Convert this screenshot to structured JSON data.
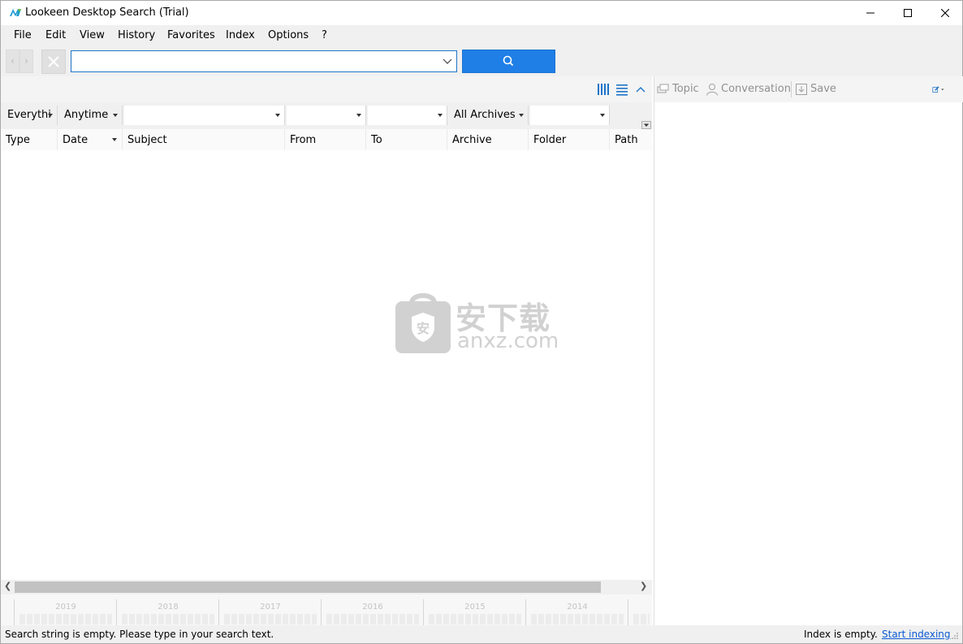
{
  "window": {
    "title": "Lookeen Desktop Search (Trial)",
    "controls": {
      "minimize": "─",
      "maximize": "☐",
      "close": "✕"
    }
  },
  "menu": {
    "items": [
      "File",
      "Edit",
      "View",
      "History",
      "Favorites",
      "Index",
      "Options",
      "?"
    ]
  },
  "toolbar": {
    "back_icon": "‹",
    "forward_icon": "›",
    "search_value": "",
    "search_placeholder": "",
    "search_button_color": "#1f7fe6"
  },
  "filters": [
    {
      "label": "Everythin"
    },
    {
      "label": "Anytime"
    },
    {
      "label": ""
    },
    {
      "label": ""
    },
    {
      "label": ""
    },
    {
      "label": "All Archives"
    },
    {
      "label": ""
    }
  ],
  "columns": [
    "Type",
    "Date",
    "Subject",
    "From",
    "To",
    "Archive",
    "Folder",
    "Path"
  ],
  "timeline": {
    "years": [
      "2019",
      "2018",
      "2017",
      "2016",
      "2015",
      "2014"
    ]
  },
  "preview_toolbar": {
    "topic_label": "Topic",
    "conversation_label": "Conversation",
    "save_label": "Save"
  },
  "watermark": {
    "chinese": "安下载",
    "latin": "anxz.com"
  },
  "status": {
    "message": "Search string is empty. Please type in your search text.",
    "index_state": "Index is empty.",
    "start_indexing": "Start indexing"
  },
  "colors": {
    "accent": "#1f7fe6",
    "link": "#0b5ad3",
    "disabled_text": "#909090"
  }
}
